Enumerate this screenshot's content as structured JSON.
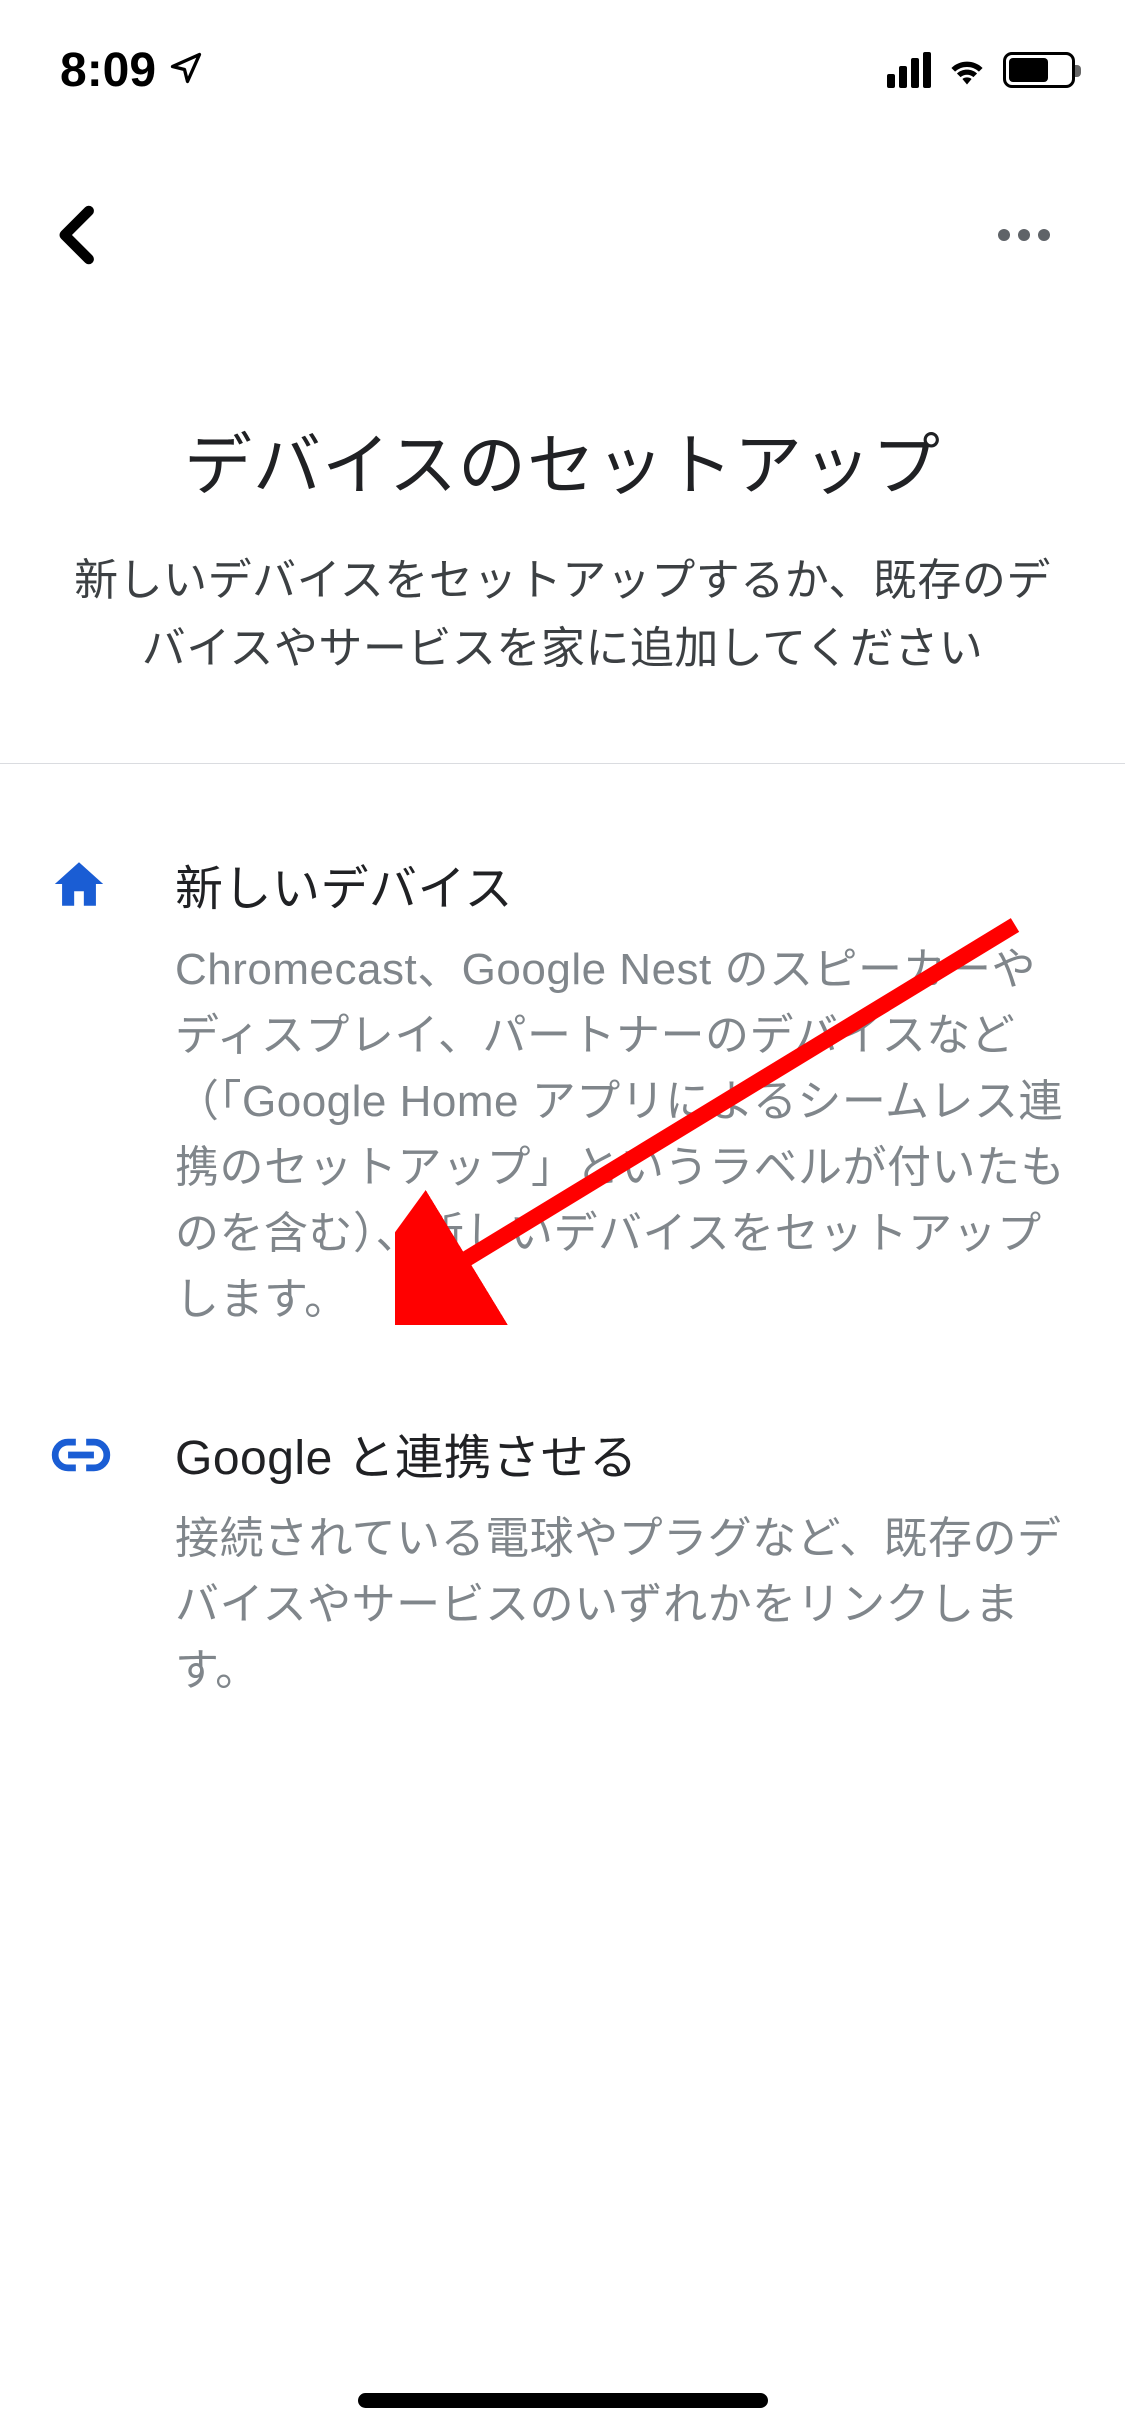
{
  "status": {
    "time": "8:09"
  },
  "header": {
    "title": "デバイスのセットアップ",
    "subtitle": "新しいデバイスをセットアップするか、既存のデバイスやサービスを家に追加してください"
  },
  "options": [
    {
      "icon": "home-icon",
      "title": "新しいデバイス",
      "description": "Chromecast、Google Nest のスピーカーやディスプレイ、パートナーのデバイスなど（「Google Home アプリによるシームレス連携のセットアップ」というラベルが付いたものを含む）、新しいデバイスをセットアップします。"
    },
    {
      "icon": "link-icon",
      "title": "Google と連携させる",
      "description": "接続されている電球やプラグなど、既存のデバイスやサービスのいずれかをリンクします。"
    }
  ],
  "colors": {
    "primary": "#1a73e8",
    "text": "#202124",
    "textSecondary": "#80868b",
    "annotation": "#ff0000"
  }
}
